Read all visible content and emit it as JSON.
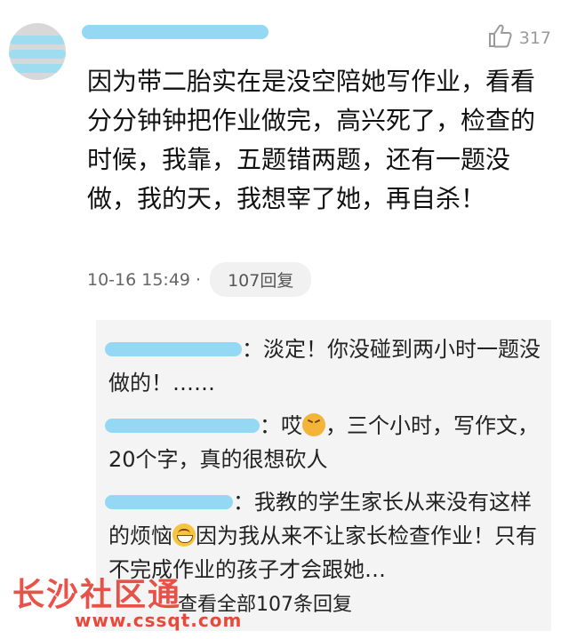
{
  "comment": {
    "like_count": "317",
    "text": "因为带二胎实在是没空陪她写作业，看看分分钟钟把作业做完，高兴死了，检查的时候，我靠，五题错两题，还有一题没做，我的天，我想宰了她，再自杀！",
    "timestamp": "10-16 15:49",
    "dot": "·",
    "reply_count_label": "107回复"
  },
  "replies": [
    {
      "text": "：淡定！你没碰到两小时一题没做的！……"
    },
    {
      "text_a": "：哎",
      "text_b": "，三个小时，写作文，20个字，真的很想砍人"
    },
    {
      "text_a": "：我教的学生家长从来没有这样的烦恼",
      "text_b": "因为我从来不让家长检查作业！只有不完成作业的孩子才会跟她…"
    }
  ],
  "view_all": "查看全部107条回复",
  "watermark": {
    "text": "长沙社区通",
    "url": "www.cssqt.com"
  }
}
